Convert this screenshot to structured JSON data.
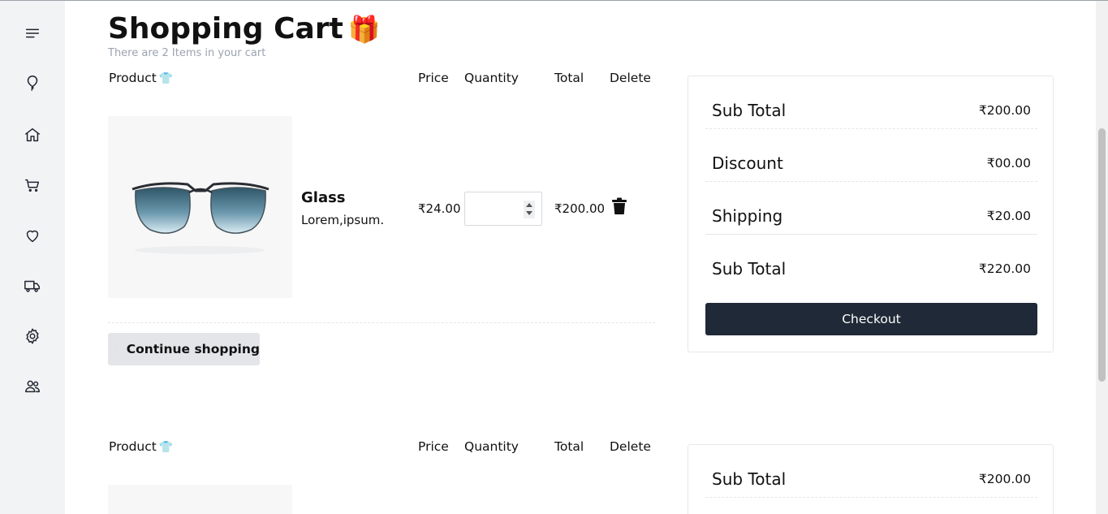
{
  "header": {
    "title": "Shopping Cart",
    "title_emoji": "🎁",
    "subtitle": "There are 2 Items in your cart"
  },
  "table": {
    "columns": {
      "product": "Product",
      "product_emoji": "👕",
      "price": "Price",
      "quantity": "Quantity",
      "total": "Total",
      "delete": "Delete"
    }
  },
  "items": [
    {
      "name": "Glass",
      "description": "Lorem,ipsum.",
      "price": "₹24.00",
      "quantity": "",
      "total": "₹200.00"
    }
  ],
  "continue_label": "Continue shopping",
  "summary": {
    "rows": [
      {
        "label": "Sub Total",
        "value": "₹200.00"
      },
      {
        "label": "Discount",
        "value": "₹00.00"
      },
      {
        "label": "Shipping",
        "value": "₹20.00"
      },
      {
        "label": "Sub Total",
        "value": "₹220.00"
      }
    ],
    "checkout_label": "Checkout"
  },
  "sidebar": {
    "icons": [
      "menu-icon",
      "balloon-icon",
      "home-icon",
      "cart-icon",
      "heart-icon",
      "truck-icon",
      "gear-icon",
      "users-icon"
    ]
  },
  "colors": {
    "sidebar_bg": "#f2f3f5",
    "checkout_bg": "#1f2937",
    "continue_bg": "#e3e5e8",
    "subtitle": "#9ba3af"
  }
}
